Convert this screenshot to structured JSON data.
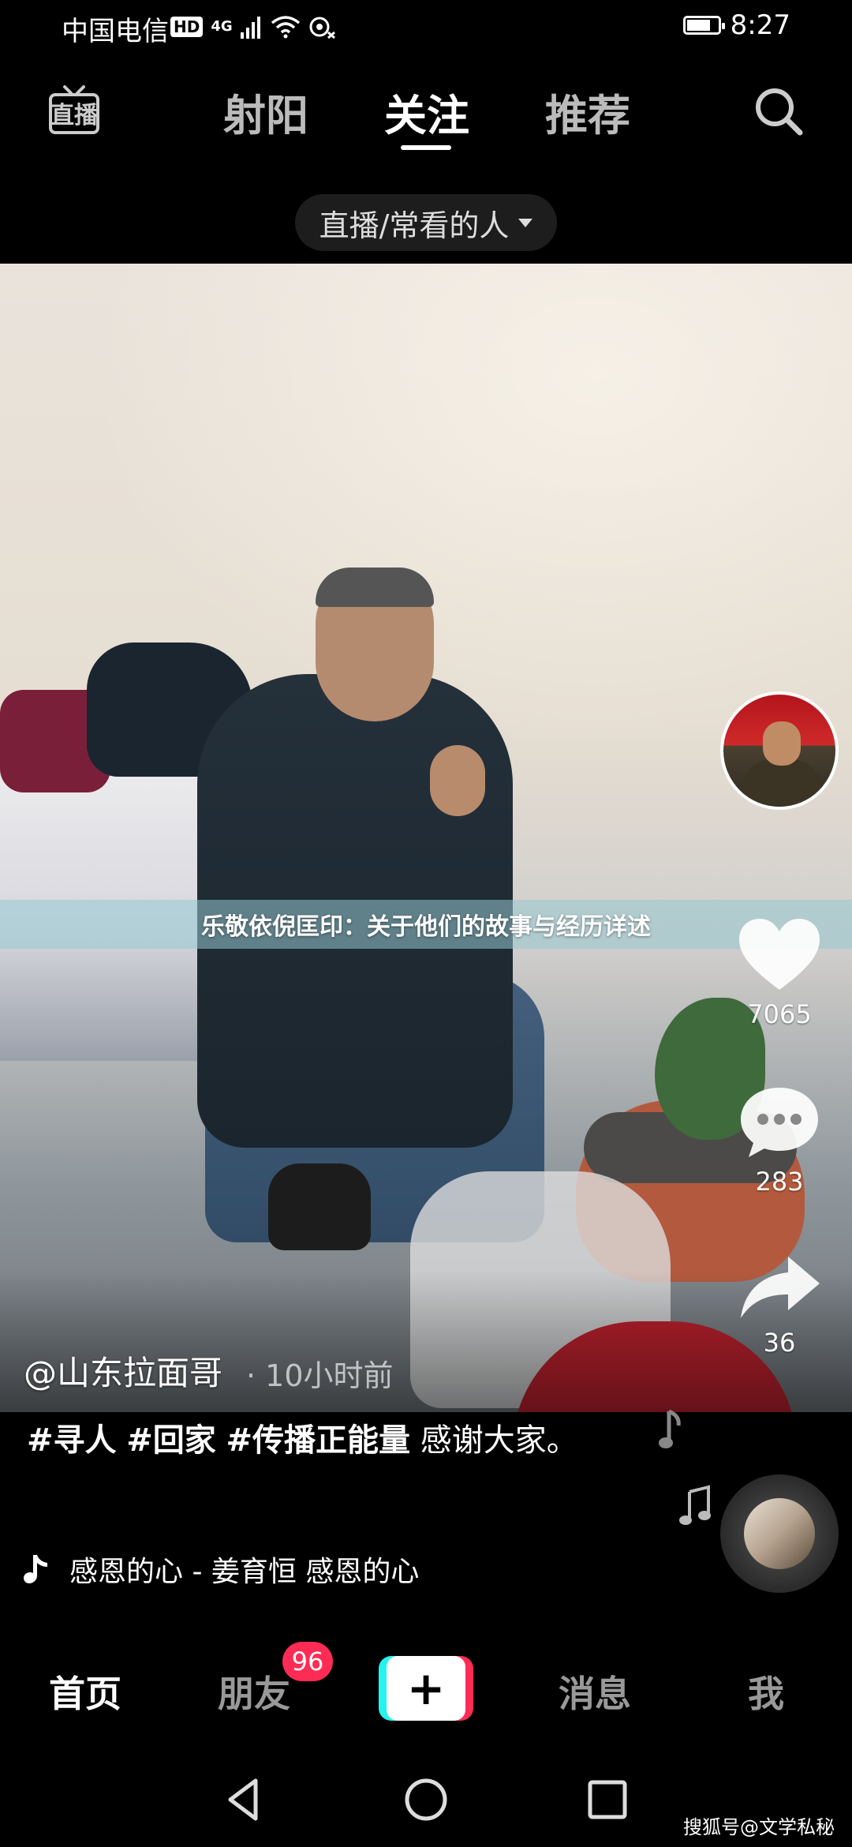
{
  "status_bar": {
    "carrier": "中国电信",
    "hd": "HD",
    "network": "4G",
    "time": "8:27",
    "battery_level": 0.75
  },
  "top_nav": {
    "tabs": [
      "射阳",
      "关注",
      "推荐"
    ],
    "active_tab": "关注",
    "live_label": "直播"
  },
  "filter": {
    "label": "直播/常看的人"
  },
  "video": {
    "overlay_title": "乐敬依倪匡印：关于他们的故事与经历详述",
    "likes": "7065",
    "comments": "283",
    "shares": "36",
    "author": "@山东拉面哥",
    "time_ago": "· 10小时前",
    "caption_tags": [
      "#寻人",
      "#回家",
      "#传播正能量"
    ],
    "caption_text": "感谢大家。",
    "music": "感恩的心 - 姜育恒   感恩的心"
  },
  "tab_bar": {
    "home": "首页",
    "friends": "朋友",
    "friends_badge": "96",
    "create": "+",
    "messages": "消息",
    "me": "我"
  },
  "watermark": "搜狐号@文学私秘",
  "colors": {
    "accent_red": "#fe2c55",
    "accent_cyan": "#25f4ee",
    "background": "#000000"
  }
}
